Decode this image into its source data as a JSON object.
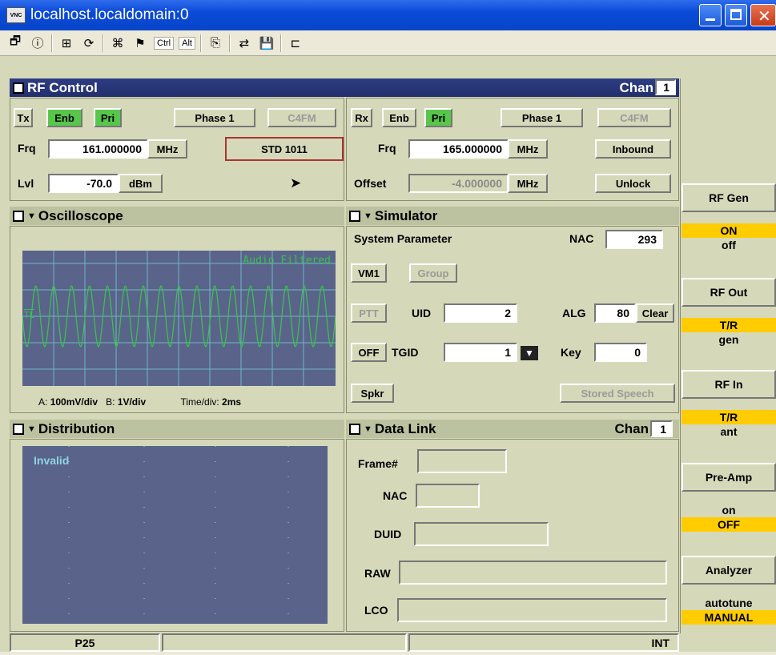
{
  "window": {
    "title": "localhost.localdomain:0",
    "vnc_logo": "VNC"
  },
  "toolbar": {
    "ctrl": "Ctrl",
    "alt": "Alt"
  },
  "rf_control": {
    "title": "RF Control",
    "chan_label": "Chan",
    "chan": "1",
    "tx": {
      "tx": "Tx",
      "enb": "Enb",
      "pri": "Pri",
      "phase": "Phase 1",
      "mod": "C4FM",
      "frq_label": "Frq",
      "frq": "161.000000",
      "frq_unit": "MHz",
      "std": "STD 1011",
      "lvl_label": "Lvl",
      "lvl": "-70.0",
      "lvl_unit": "dBm"
    },
    "rx": {
      "rx": "Rx",
      "enb": "Enb",
      "pri": "Pri",
      "phase": "Phase 1",
      "mod": "C4FM",
      "frq_label": "Frq",
      "frq": "165.000000",
      "frq_unit": "MHz",
      "inbound": "Inbound",
      "offset_label": "Offset",
      "offset": "-4.000000",
      "offset_unit": "MHz",
      "unlock": "Unlock"
    }
  },
  "oscilloscope": {
    "title": "Oscilloscope",
    "trace": "Audio Filtered",
    "marker": "TL",
    "a_label": "A:",
    "a_value": "100mV/div",
    "b_label": "B:",
    "b_value": "1V/div",
    "time_label": "Time/div:",
    "time_value": "2ms"
  },
  "simulator": {
    "title": "Simulator",
    "sys_param": "System Parameter",
    "nac_label": "NAC",
    "nac": "293",
    "vm1": "VM1",
    "group": "Group",
    "ptt": "PTT",
    "uid_label": "UID",
    "uid": "2",
    "alg_label": "ALG",
    "alg": "80",
    "clear": "Clear",
    "off": "OFF",
    "tgid_label": "TGID",
    "tgid": "1",
    "key_label": "Key",
    "key": "0",
    "spkr": "Spkr",
    "stored": "Stored Speech"
  },
  "distribution": {
    "title": "Distribution",
    "status": "Invalid"
  },
  "data_link": {
    "title": "Data Link",
    "chan_label": "Chan",
    "chan": "1",
    "frame": "Frame#",
    "nac": "NAC",
    "duid": "DUID",
    "raw": "RAW",
    "lco": "LCO"
  },
  "side": {
    "rf_gen": "RF Gen",
    "rf_gen_on": "ON",
    "rf_gen_off": "off",
    "rf_out": "RF Out",
    "rf_out_a": "T/R",
    "rf_out_b": "gen",
    "rf_in": "RF In",
    "rf_in_a": "T/R",
    "rf_in_b": "ant",
    "preamp": "Pre-Amp",
    "preamp_a": "on",
    "preamp_b": "OFF",
    "analyzer": "Analyzer",
    "analyzer_a": "autotune",
    "analyzer_b": "MANUAL"
  },
  "statusbar": {
    "mode": "P25",
    "ref": "INT"
  },
  "colors": {
    "accent": "#222f6c",
    "enabled": "#57c64b",
    "highlight": "#ffcc00",
    "trace": "#39c24d"
  }
}
